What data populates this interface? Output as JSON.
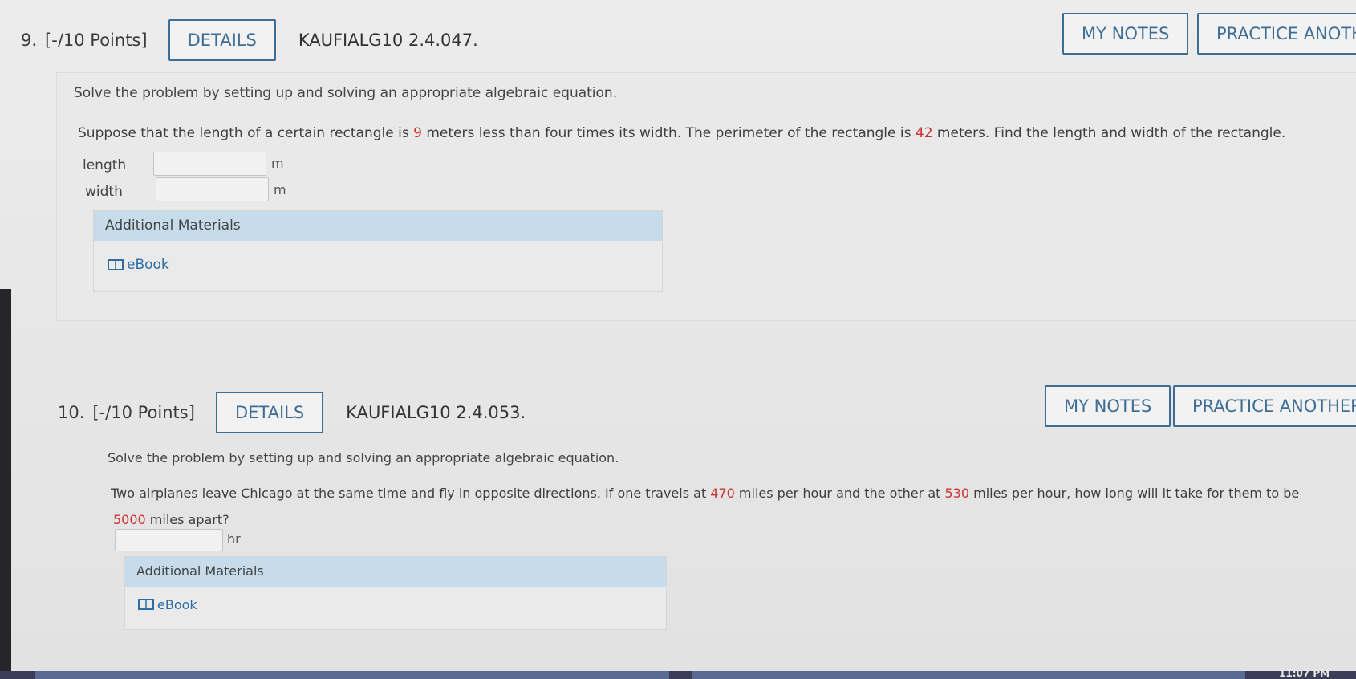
{
  "q9": {
    "number": "9.",
    "points": "[-/10 Points]",
    "details": "DETAILS",
    "code": "KAUFIALG10 2.4.047.",
    "my_notes": "MY NOTES",
    "practice": "PRACTICE ANOTH",
    "instruction": "Solve the problem by setting up and solving an appropriate algebraic equation.",
    "problem_parts": [
      "Suppose that the length of a certain rectangle is ",
      "9",
      " meters less than four times its width. The perimeter of the rectangle is ",
      "42",
      " meters. Find the length and width of the rectangle."
    ],
    "length_label": "length",
    "width_label": "width",
    "unit": "m",
    "materials_title": "Additional Materials",
    "ebook": "eBook"
  },
  "q10": {
    "number": "10.",
    "points": "[-/10 Points]",
    "details": "DETAILS",
    "code": "KAUFIALG10 2.4.053.",
    "my_notes": "MY NOTES",
    "practice": "PRACTICE ANOTHER",
    "instruction": "Solve the problem by setting up and solving an appropriate algebraic equation.",
    "problem_parts": [
      "Two airplanes leave Chicago at the same time and fly in opposite directions. If one travels at ",
      "470",
      " miles per hour and the other at ",
      "530",
      " miles per hour, how long will it take for them to be"
    ],
    "problem_line2_parts": [
      "5000",
      " miles apart?"
    ],
    "unit": "hr",
    "materials_title": "Additional Materials",
    "ebook": "eBook"
  },
  "taskbar": {
    "clock": "11:07 PM"
  },
  "colors": {
    "accent": "#3d6d95",
    "highlight_number": "#cc3333",
    "materials_header": "#c7dcea"
  },
  "icons": [
    "book-icon"
  ]
}
